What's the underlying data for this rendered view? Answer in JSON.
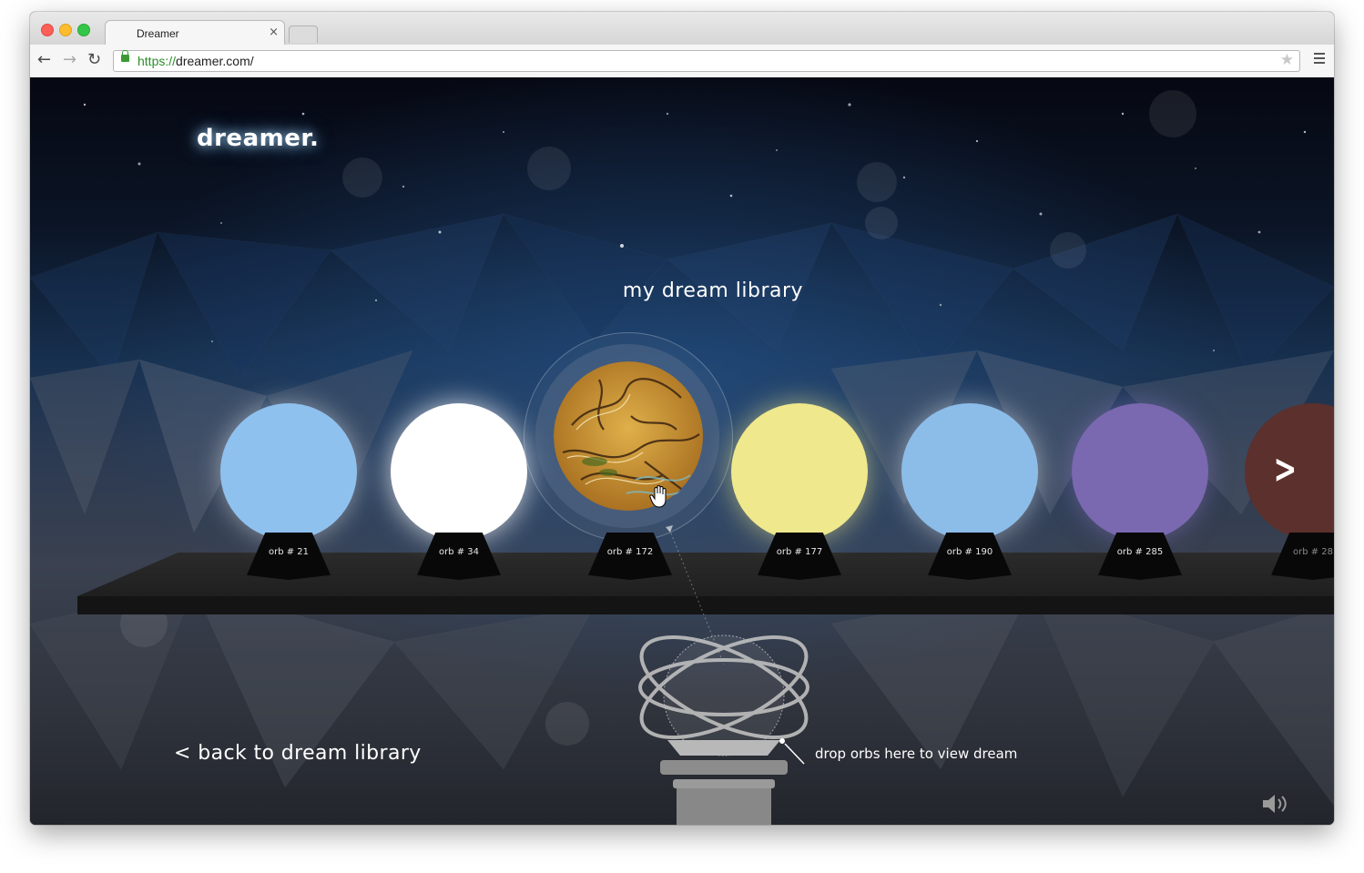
{
  "browser": {
    "tab_title": "Dreamer",
    "tab_close": "×",
    "url_scheme": "https://",
    "url_rest": "dreamer.com/",
    "star": "★"
  },
  "page": {
    "logo": "dreamer.",
    "heading": "my dream library",
    "back_link": "< back to dream library",
    "drop_hint": "drop orbs here to view dream",
    "next_arrow": ">"
  },
  "orbs": [
    {
      "label": "orb # 21",
      "color": "#8fc1ef"
    },
    {
      "label": "orb # 34",
      "color": "#ffffff"
    },
    {
      "label": "orb # 172",
      "color": "pattern"
    },
    {
      "label": "orb # 177",
      "color": "#efe88c"
    },
    {
      "label": "orb # 190",
      "color": "#8cbde9"
    },
    {
      "label": "orb # 285",
      "color": "#7a68b0"
    },
    {
      "label": "orb # 28",
      "color": "#5c302c"
    }
  ],
  "icons": {
    "sound": "speaker-icon",
    "cursor": "grab-hand-icon",
    "back": "back-arrow-icon",
    "forward": "forward-arrow-icon",
    "reload": "reload-icon"
  }
}
